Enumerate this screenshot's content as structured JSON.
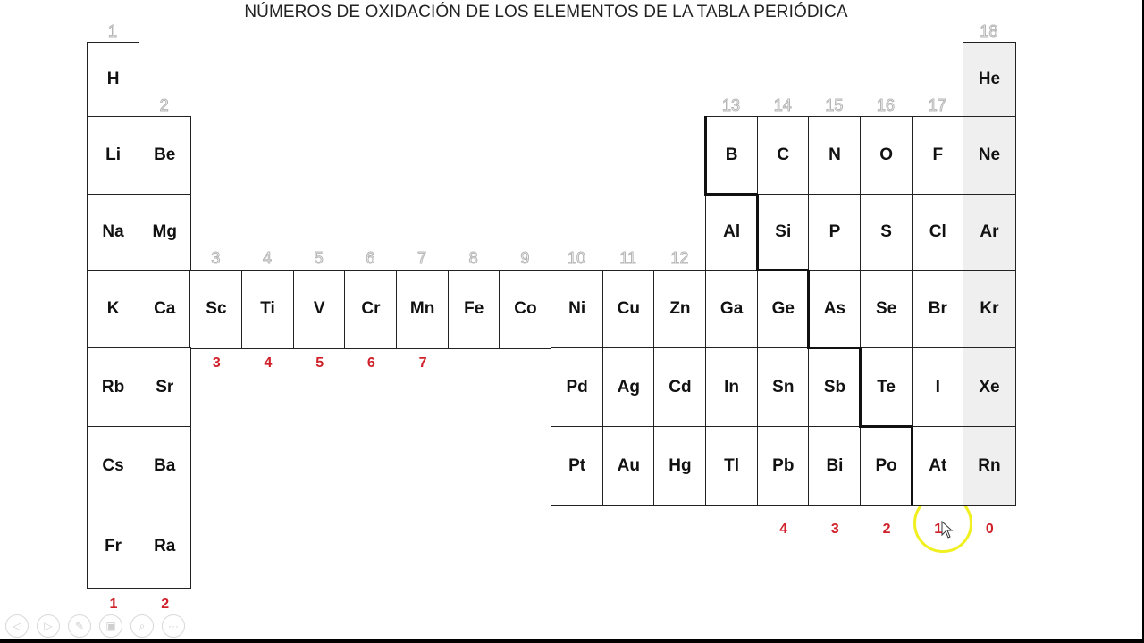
{
  "title": "NÚMEROS DE OXIDACIÓN DE LOS ELEMENTOS DE LA TABLA PERIÓDICA",
  "group_numbers": [
    "1",
    "2",
    "3",
    "4",
    "5",
    "6",
    "7",
    "8",
    "9",
    "10",
    "11",
    "12",
    "13",
    "14",
    "15",
    "16",
    "17",
    "18"
  ],
  "elements": [
    {
      "symbol": "H",
      "group": 1,
      "period": 1
    },
    {
      "symbol": "He",
      "group": 18,
      "period": 1,
      "noble": true
    },
    {
      "symbol": "Li",
      "group": 1,
      "period": 2
    },
    {
      "symbol": "Be",
      "group": 2,
      "period": 2
    },
    {
      "symbol": "B",
      "group": 13,
      "period": 2
    },
    {
      "symbol": "C",
      "group": 14,
      "period": 2
    },
    {
      "symbol": "N",
      "group": 15,
      "period": 2
    },
    {
      "symbol": "O",
      "group": 16,
      "period": 2
    },
    {
      "symbol": "F",
      "group": 17,
      "period": 2
    },
    {
      "symbol": "Ne",
      "group": 18,
      "period": 2,
      "noble": true
    },
    {
      "symbol": "Na",
      "group": 1,
      "period": 3
    },
    {
      "symbol": "Mg",
      "group": 2,
      "period": 3
    },
    {
      "symbol": "Al",
      "group": 13,
      "period": 3
    },
    {
      "symbol": "Si",
      "group": 14,
      "period": 3
    },
    {
      "symbol": "P",
      "group": 15,
      "period": 3
    },
    {
      "symbol": "S",
      "group": 16,
      "period": 3
    },
    {
      "symbol": "Cl",
      "group": 17,
      "period": 3
    },
    {
      "symbol": "Ar",
      "group": 18,
      "period": 3,
      "noble": true
    },
    {
      "symbol": "K",
      "group": 1,
      "period": 4
    },
    {
      "symbol": "Ca",
      "group": 2,
      "period": 4
    },
    {
      "symbol": "Sc",
      "group": 3,
      "period": 4
    },
    {
      "symbol": "Ti",
      "group": 4,
      "period": 4
    },
    {
      "symbol": "V",
      "group": 5,
      "period": 4
    },
    {
      "symbol": "Cr",
      "group": 6,
      "period": 4
    },
    {
      "symbol": "Mn",
      "group": 7,
      "period": 4
    },
    {
      "symbol": "Fe",
      "group": 8,
      "period": 4
    },
    {
      "symbol": "Co",
      "group": 9,
      "period": 4
    },
    {
      "symbol": "Ni",
      "group": 10,
      "period": 4
    },
    {
      "symbol": "Cu",
      "group": 11,
      "period": 4
    },
    {
      "symbol": "Zn",
      "group": 12,
      "period": 4
    },
    {
      "symbol": "Ga",
      "group": 13,
      "period": 4
    },
    {
      "symbol": "Ge",
      "group": 14,
      "period": 4
    },
    {
      "symbol": "As",
      "group": 15,
      "period": 4
    },
    {
      "symbol": "Se",
      "group": 16,
      "period": 4
    },
    {
      "symbol": "Br",
      "group": 17,
      "period": 4
    },
    {
      "symbol": "Kr",
      "group": 18,
      "period": 4,
      "noble": true
    },
    {
      "symbol": "Rb",
      "group": 1,
      "period": 5
    },
    {
      "symbol": "Sr",
      "group": 2,
      "period": 5
    },
    {
      "symbol": "Pd",
      "group": 10,
      "period": 5
    },
    {
      "symbol": "Ag",
      "group": 11,
      "period": 5
    },
    {
      "symbol": "Cd",
      "group": 12,
      "period": 5
    },
    {
      "symbol": "In",
      "group": 13,
      "period": 5
    },
    {
      "symbol": "Sn",
      "group": 14,
      "period": 5
    },
    {
      "symbol": "Sb",
      "group": 15,
      "period": 5
    },
    {
      "symbol": "Te",
      "group": 16,
      "period": 5
    },
    {
      "symbol": "I",
      "group": 17,
      "period": 5
    },
    {
      "symbol": "Xe",
      "group": 18,
      "period": 5,
      "noble": true
    },
    {
      "symbol": "Cs",
      "group": 1,
      "period": 6
    },
    {
      "symbol": "Ba",
      "group": 2,
      "period": 6
    },
    {
      "symbol": "Pt",
      "group": 10,
      "period": 6
    },
    {
      "symbol": "Au",
      "group": 11,
      "period": 6
    },
    {
      "symbol": "Hg",
      "group": 12,
      "period": 6
    },
    {
      "symbol": "Tl",
      "group": 13,
      "period": 6
    },
    {
      "symbol": "Pb",
      "group": 14,
      "period": 6
    },
    {
      "symbol": "Bi",
      "group": 15,
      "period": 6
    },
    {
      "symbol": "Po",
      "group": 16,
      "period": 6
    },
    {
      "symbol": "At",
      "group": 17,
      "period": 6
    },
    {
      "symbol": "Rn",
      "group": 18,
      "period": 6,
      "noble": true
    },
    {
      "symbol": "Fr",
      "group": 1,
      "period": 7
    },
    {
      "symbol": "Ra",
      "group": 2,
      "period": 7
    }
  ],
  "oxidation_labels": {
    "bottom_groups_1_2": [
      {
        "group": 1,
        "value": "1"
      },
      {
        "group": 2,
        "value": "2"
      }
    ],
    "transition_3_7": [
      {
        "group": 3,
        "value": "3"
      },
      {
        "group": 4,
        "value": "4"
      },
      {
        "group": 5,
        "value": "5"
      },
      {
        "group": 6,
        "value": "6"
      },
      {
        "group": 7,
        "value": "7"
      }
    ],
    "bottom_groups_14_18": [
      {
        "group": 14,
        "value": "4"
      },
      {
        "group": 15,
        "value": "3"
      },
      {
        "group": 16,
        "value": "2"
      },
      {
        "group": 17,
        "value": "1"
      },
      {
        "group": 18,
        "value": "0"
      }
    ]
  },
  "colors": {
    "oxidation_red": "#d0202a",
    "noble_gas_fill": "#efefef",
    "cursor_highlight": "#f0f020"
  },
  "presentation_controls": [
    {
      "name": "previous",
      "icon": "◁"
    },
    {
      "name": "next",
      "icon": "▷"
    },
    {
      "name": "pen",
      "icon": "✎"
    },
    {
      "name": "slides",
      "icon": "▣"
    },
    {
      "name": "zoom",
      "icon": "⌕"
    },
    {
      "name": "more",
      "icon": "···"
    }
  ]
}
